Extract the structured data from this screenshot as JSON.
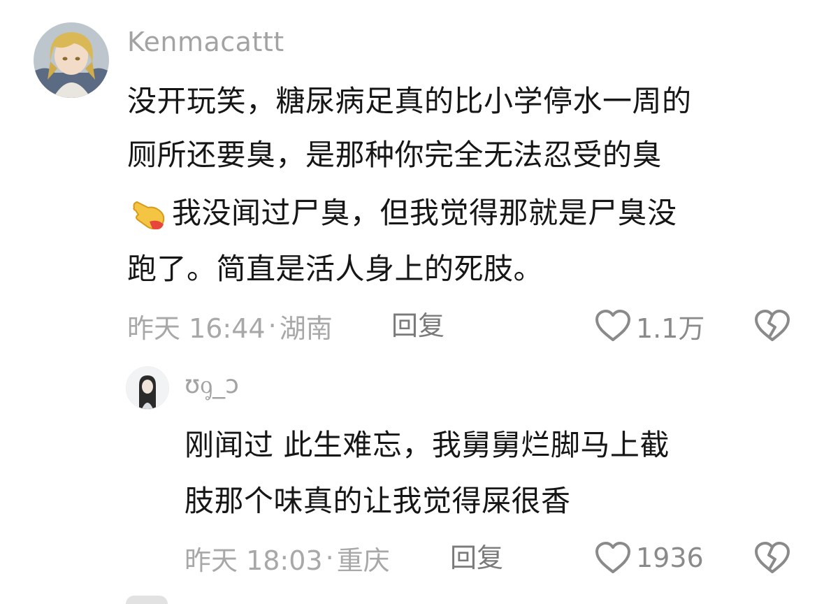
{
  "comment": {
    "username": "Kenmacattt",
    "lines": [
      "没开玩笑，糖尿病足真的比小学停水一周的",
      "厕所还要臭，是那种你完全无法忍受的臭",
      "我没闻过尸臭，但我觉得那就是尸臭没",
      "跑了。简直是活人身上的死肢。"
    ],
    "emoji": "👈",
    "time": "昨天 16:44",
    "location": "湖南",
    "reply_label": "回复",
    "likes": "1.1万"
  },
  "reply": {
    "username": "ʊᧁ_ɔ",
    "lines": [
      "刚闻过  此生难忘，我舅舅烂脚马上截",
      "肢那个味真的让我觉得屎很香"
    ],
    "time": "昨天 18:03",
    "location": "重庆",
    "reply_label": "回复",
    "likes": "1936"
  },
  "colors": {
    "meta": "#a8a8a8",
    "reply": "#7a7a7a",
    "icon": "#8a8a8a"
  },
  "icons": [
    "heart-outline-icon",
    "broken-heart-icon",
    "pointing-hand-emoji"
  ]
}
